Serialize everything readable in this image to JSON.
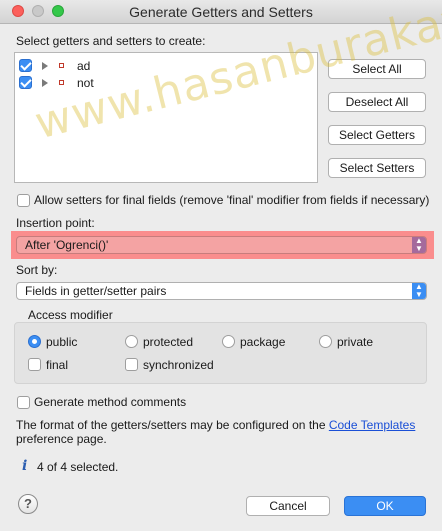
{
  "window": {
    "title": "Generate Getters and Setters"
  },
  "header": {
    "select_label": "Select getters and setters to create:"
  },
  "fields": [
    {
      "name": "ad",
      "checked": true
    },
    {
      "name": "not",
      "checked": true
    }
  ],
  "side_buttons": {
    "select_all": "Select All",
    "deselect_all": "Deselect All",
    "select_getters": "Select Getters",
    "select_setters": "Select Setters"
  },
  "allow_setters_final": {
    "label": "Allow setters for final fields (remove 'final' modifier from fields if necessary)",
    "checked": false
  },
  "insertion_point": {
    "label": "Insertion point:",
    "value": "After 'Ogrenci()'"
  },
  "sort_by": {
    "label": "Sort by:",
    "value": "Fields in getter/setter pairs"
  },
  "access_modifier": {
    "label": "Access modifier",
    "options": [
      "public",
      "protected",
      "package",
      "private"
    ],
    "selected": "public",
    "final_label": "final",
    "synchronized_label": "synchronized"
  },
  "generate_comments": {
    "label": "Generate method comments",
    "checked": false
  },
  "info": {
    "text_before": "The format of the getters/setters may be configured on the",
    "link_text": "Code Templates",
    "text_after": "preference page."
  },
  "status": {
    "text": "4 of 4 selected."
  },
  "footer": {
    "help_glyph": "?",
    "cancel": "Cancel",
    "ok": "OK"
  },
  "watermark": {
    "text": "www.hasanburakavci.com"
  },
  "colors": {
    "accent": "#3b8ef3",
    "highlight": "#ff6e6e",
    "link": "#1a4fd6"
  }
}
